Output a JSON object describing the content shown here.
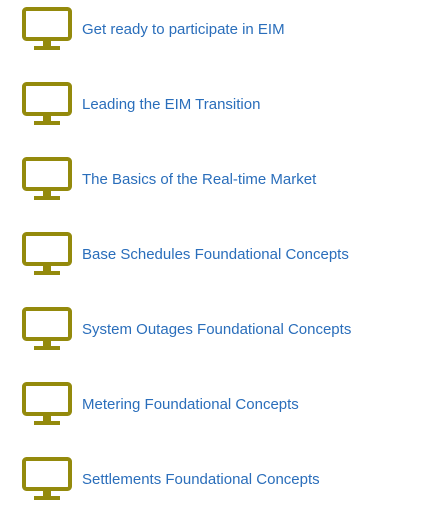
{
  "icon_color": "#948a0c",
  "icon_name": "monitor-icon",
  "link_color": "#2a6ebb",
  "courses": [
    {
      "label": "Get ready to participate in EIM"
    },
    {
      "label": "Leading the EIM Transition"
    },
    {
      "label": "The Basics of the Real-time Market"
    },
    {
      "label": "Base Schedules Foundational Concepts"
    },
    {
      "label": "System Outages Foundational Concepts"
    },
    {
      "label": "Metering Foundational Concepts"
    },
    {
      "label": "Settlements Foundational Concepts"
    }
  ]
}
